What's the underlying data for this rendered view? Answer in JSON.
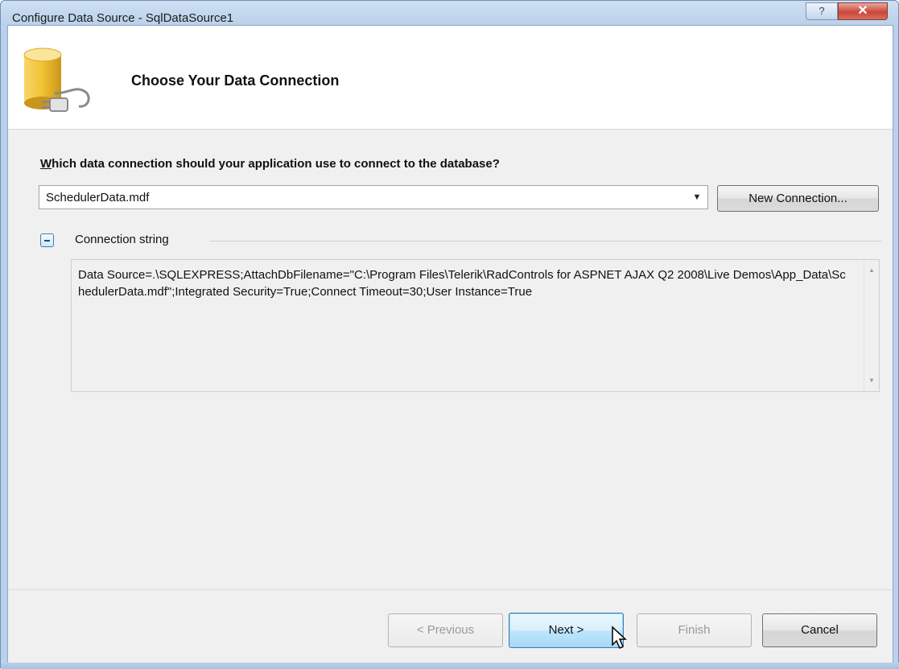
{
  "window": {
    "title": "Configure Data Source - SqlDataSource1",
    "help_label": "?",
    "close_label": "✕"
  },
  "header": {
    "title": "Choose Your Data Connection",
    "icon": "database-plug-icon"
  },
  "main": {
    "question_first": "W",
    "question_rest": "hich data connection should your application use to connect to the database?",
    "connection_select_value": "SchedulerData.mdf",
    "new_connection_label": "New Connection...",
    "section_label": "Connection string",
    "connection_string": "Data Source=.\\SQLEXPRESS;AttachDbFilename=\"C:\\Program Files\\Telerik\\RadControls for ASPNET AJAX Q2 2008\\Live Demos\\App_Data\\SchedulerData.mdf\";Integrated Security=True;Connect Timeout=30;User Instance=True"
  },
  "footer": {
    "previous_label": "< Previous",
    "next_label": "Next >",
    "finish_label": "Finish",
    "cancel_label": "Cancel"
  },
  "colors": {
    "titlebar": "#b9d1ea",
    "close_button": "#c9473a",
    "primary_button": "#bee6fd"
  }
}
